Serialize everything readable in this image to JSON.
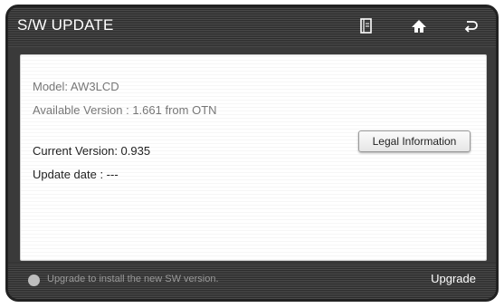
{
  "header": {
    "title": "S/W UPDATE",
    "icons": [
      "manual-icon",
      "home-icon",
      "back-icon"
    ]
  },
  "info": {
    "model": "Model: AW3LCD",
    "available_version": "Available Version : 1.661 from OTN",
    "current_version": "Current Version: 0.935",
    "update_date": "Update date : ---"
  },
  "buttons": {
    "legal_information": "Legal Information"
  },
  "footer": {
    "hint": "Upgrade to install the new SW version.",
    "upgrade_label": "Upgrade"
  }
}
